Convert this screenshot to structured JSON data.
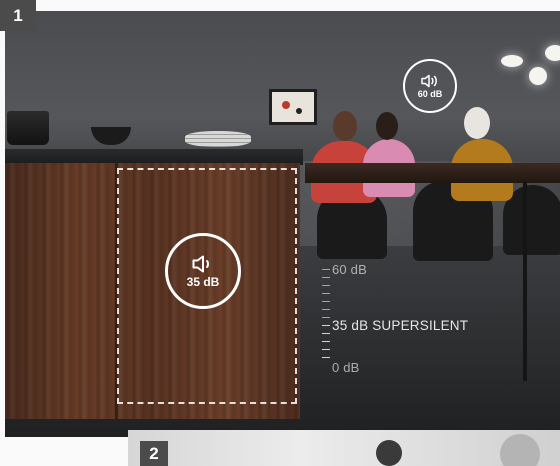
{
  "panels": [
    {
      "number": "1",
      "badges": [
        {
          "icon": "speaker-icon",
          "value": "60 dB"
        },
        {
          "icon": "speaker-icon",
          "value": "35 dB"
        }
      ],
      "scale": {
        "top_label": "60 dB",
        "mid_label": "35 dB SUPERSILENT",
        "bottom_label": "0 dB"
      }
    },
    {
      "number": "2"
    }
  ],
  "colors": {
    "tag_background": "#4b4b4b",
    "badge_stroke": "#ffffff"
  }
}
